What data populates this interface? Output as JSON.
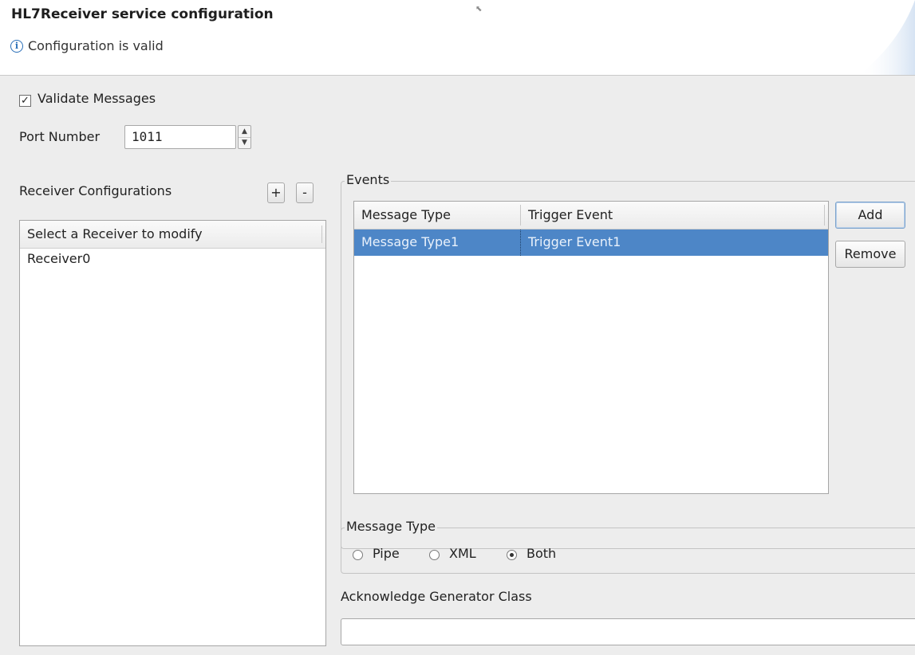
{
  "header": {
    "title": "HL7Receiver service configuration",
    "status_icon": "info-icon",
    "status_text": "Configuration is valid"
  },
  "form": {
    "validate_messages": {
      "label": "Validate Messages",
      "checked": true
    },
    "port_number": {
      "label": "Port Number",
      "value": "1011"
    }
  },
  "receivers": {
    "label": "Receiver Configurations",
    "add_label": "+",
    "remove_label": "-",
    "list_header": "Select a Receiver to modify",
    "items": [
      "Receiver0"
    ]
  },
  "events": {
    "title": "Events",
    "columns": [
      "Message Type",
      "Trigger Event"
    ],
    "rows": [
      {
        "message_type": "Message Type1",
        "trigger_event": "Trigger Event1",
        "selected": true
      }
    ],
    "add_label": "Add",
    "remove_label": "Remove"
  },
  "message_type": {
    "title": "Message Type",
    "options": [
      {
        "label": "Pipe",
        "selected": false
      },
      {
        "label": "XML",
        "selected": false
      },
      {
        "label": "Both",
        "selected": true
      }
    ]
  },
  "ack_generator": {
    "label": "Acknowledge Generator Class",
    "value": ""
  },
  "colors": {
    "selection": "#4d86c7",
    "info_accent": "#2a6fb8"
  }
}
